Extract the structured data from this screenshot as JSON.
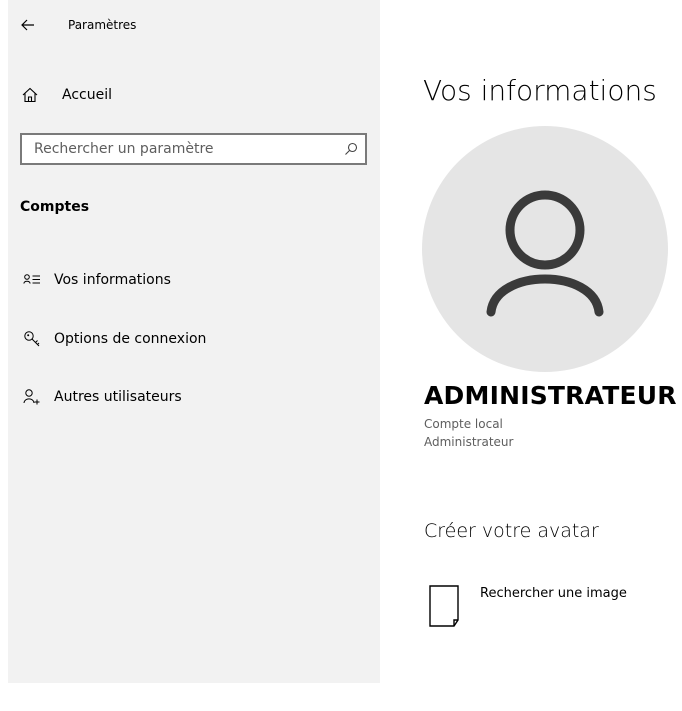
{
  "header": {
    "app_title": "Paramètres",
    "back_icon": "back-arrow-icon"
  },
  "sidebar": {
    "home": {
      "label": "Accueil",
      "icon": "home-icon"
    },
    "search": {
      "placeholder": "Rechercher un paramètre",
      "value": "",
      "icon": "search-icon"
    },
    "section_title": "Comptes",
    "items": [
      {
        "label": "Vos informations",
        "icon": "contact-info-icon",
        "selected": true
      },
      {
        "label": "Options de connexion",
        "icon": "key-icon",
        "selected": false
      },
      {
        "label": "Autres utilisateurs",
        "icon": "add-person-icon",
        "selected": false
      }
    ]
  },
  "main": {
    "title": "Vos informations",
    "avatar_icon": "user-avatar-icon",
    "user_name": "ADMINISTRATEUR",
    "account_type": "Compte local",
    "account_role": "Administrateur",
    "avatar_heading": "Créer votre avatar",
    "browse_label": "Rechercher une image",
    "browse_icon": "file-icon"
  },
  "colors": {
    "sidebar_bg": "#f2f2f2",
    "avatar_bg": "#e5e5e5",
    "secondary_text": "#5e5e5e",
    "search_border": "#7a7a7a"
  }
}
